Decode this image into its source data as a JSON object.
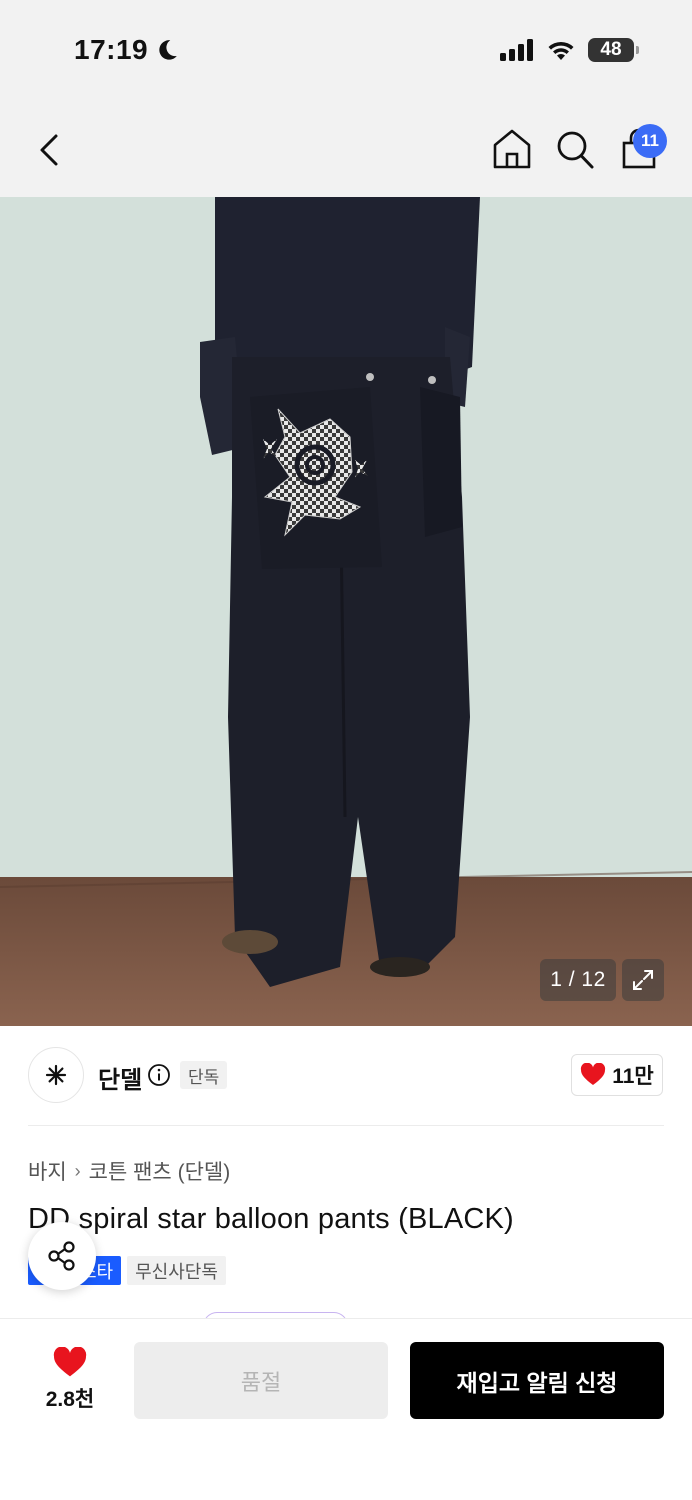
{
  "status_bar": {
    "time": "17:19",
    "battery": "48"
  },
  "nav": {
    "cart_count": "11"
  },
  "gallery": {
    "counter": "1 / 12"
  },
  "brand": {
    "name": "단델",
    "exclusive_label": "단독",
    "like_count": "11만"
  },
  "product": {
    "breadcrumb": [
      "바지",
      "코튼 팬츠 (단델)"
    ],
    "title": "DD spiral star balloon pants (BLACK)",
    "tags": [
      "스타",
      "무신사단독"
    ]
  },
  "bottom_bar": {
    "wish_count": "2.8천",
    "soldout_label": "품절",
    "restock_label": "재입고 알림 신청"
  },
  "colors": {
    "accent_blue": "#1a5cff",
    "badge_blue": "#3b6cf6",
    "heart_red": "#e8141e",
    "primary_black": "#000000"
  },
  "icons": [
    "moon-icon",
    "signal-icon",
    "wifi-icon",
    "battery-icon",
    "back-icon",
    "home-icon",
    "search-icon",
    "cart-icon",
    "expand-icon",
    "brand-logo-icon",
    "info-icon",
    "heart-icon",
    "share-icon"
  ]
}
